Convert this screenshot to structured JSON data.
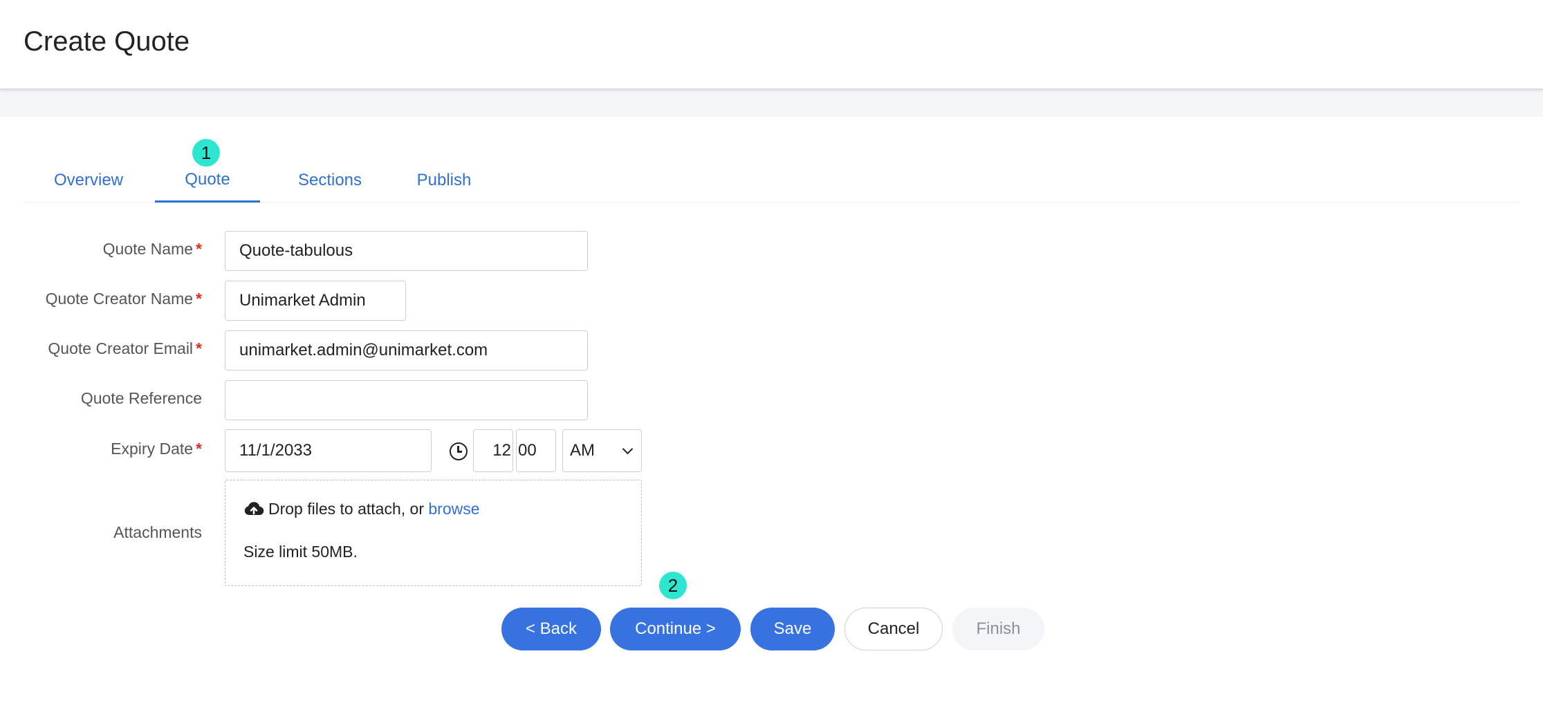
{
  "header": {
    "title": "Create Quote"
  },
  "tabs": [
    {
      "label": "Overview"
    },
    {
      "label": "Quote"
    },
    {
      "label": "Sections"
    },
    {
      "label": "Publish"
    }
  ],
  "markers": {
    "first": "1",
    "second": "2"
  },
  "form": {
    "quote_name": {
      "label": "Quote Name",
      "value": "Quote-tabulous",
      "required": "*"
    },
    "creator_name": {
      "label": "Quote Creator Name",
      "value": "Unimarket Admin",
      "required": "*"
    },
    "creator_email": {
      "label": "Quote Creator Email",
      "value": "unimarket.admin@unimarket.com",
      "required": "*"
    },
    "reference": {
      "label": "Quote Reference",
      "value": ""
    },
    "expiry": {
      "label": "Expiry Date",
      "required": "*",
      "date": "11/1/2033",
      "hour": "12",
      "minute": "00",
      "ampm": "AM"
    },
    "attachments": {
      "label": "Attachments",
      "drop_text": "Drop files to attach, or",
      "browse": "browse",
      "size_limit": "Size limit 50MB."
    }
  },
  "buttons": {
    "back": "< Back",
    "continue": "Continue >",
    "save": "Save",
    "cancel": "Cancel",
    "finish": "Finish"
  },
  "colors": {
    "primary": "#3673e0",
    "marker": "#2ee6cf",
    "link": "#2f6fd6"
  }
}
